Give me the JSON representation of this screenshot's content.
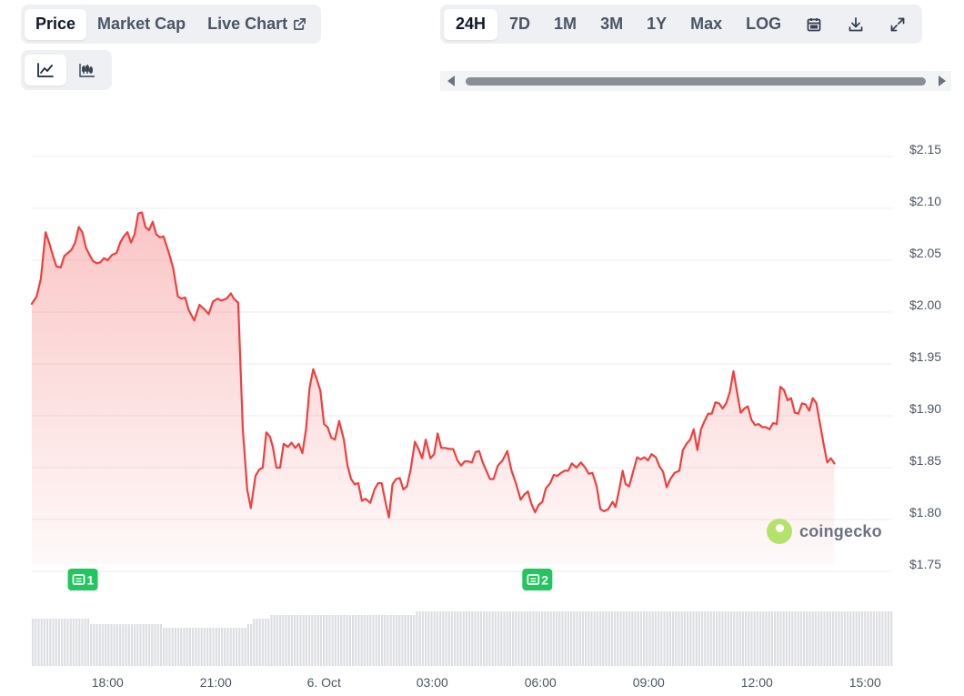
{
  "tabs": [
    {
      "label": "Price",
      "active": true
    },
    {
      "label": "Market Cap",
      "active": false
    },
    {
      "label": "Live Chart",
      "active": false,
      "icon": "external-link-icon"
    }
  ],
  "view_toggles": [
    {
      "name": "line-chart-icon",
      "active": true
    },
    {
      "name": "candlestick-icon",
      "active": false
    }
  ],
  "ranges": [
    {
      "label": "24H",
      "active": true
    },
    {
      "label": "7D",
      "active": false
    },
    {
      "label": "1M",
      "active": false
    },
    {
      "label": "3M",
      "active": false
    },
    {
      "label": "1Y",
      "active": false
    },
    {
      "label": "Max",
      "active": false
    },
    {
      "label": "LOG",
      "active": false
    }
  ],
  "range_icons": [
    "calendar-icon",
    "download-icon",
    "expand-icon"
  ],
  "watermark": {
    "text": "coingecko",
    "icon": "gecko-logo-icon"
  },
  "colors": {
    "line": "#ef3f3f",
    "event": "#22c55e",
    "volume": "#dcdee2",
    "grid": "#eceef1"
  },
  "chart_data": {
    "type": "area",
    "title": "",
    "xlabel": "",
    "ylabel": "",
    "ylim": [
      1.75,
      2.15
    ],
    "y_ticks": [
      "$2.15",
      "$2.10",
      "$2.05",
      "$2.00",
      "$1.95",
      "$1.90",
      "$1.85",
      "$1.80",
      "$1.75"
    ],
    "y_tick_values": [
      2.15,
      2.1,
      2.05,
      2.0,
      1.95,
      1.9,
      1.85,
      1.8,
      1.75
    ],
    "x_ticks": [
      "18:00",
      "21:00",
      "6. Oct",
      "03:00",
      "06:00",
      "09:00",
      "12:00",
      "15:00"
    ],
    "x_tick_hours": [
      18,
      21,
      24,
      27,
      30,
      33,
      36,
      39
    ],
    "x_range_hours": [
      15.9,
      39.75
    ],
    "grid": true,
    "legend": "none",
    "events": [
      {
        "label": "1",
        "hour": 17.3
      },
      {
        "label": "2",
        "hour": 29.9
      }
    ],
    "series": [
      {
        "points": [
          [
            15.9,
            2.001
          ],
          [
            16.03,
            2.008
          ],
          [
            16.15,
            2.025
          ],
          [
            16.28,
            2.07
          ],
          [
            16.38,
            2.06
          ],
          [
            16.48,
            2.048
          ],
          [
            16.58,
            2.037
          ],
          [
            16.7,
            2.036
          ],
          [
            16.8,
            2.047
          ],
          [
            16.9,
            2.05
          ],
          [
            17.0,
            2.053
          ],
          [
            17.1,
            2.06
          ],
          [
            17.2,
            2.075
          ],
          [
            17.3,
            2.07
          ],
          [
            17.4,
            2.055
          ],
          [
            17.5,
            2.048
          ],
          [
            17.6,
            2.042
          ],
          [
            17.7,
            2.04
          ],
          [
            17.8,
            2.041
          ],
          [
            17.9,
            2.045
          ],
          [
            18.0,
            2.043
          ],
          [
            18.12,
            2.048
          ],
          [
            18.25,
            2.05
          ],
          [
            18.35,
            2.06
          ],
          [
            18.45,
            2.066
          ],
          [
            18.55,
            2.07
          ],
          [
            18.65,
            2.06
          ],
          [
            18.75,
            2.068
          ],
          [
            18.85,
            2.088
          ],
          [
            18.95,
            2.089
          ],
          [
            19.05,
            2.075
          ],
          [
            19.15,
            2.072
          ],
          [
            19.25,
            2.08
          ],
          [
            19.35,
            2.068
          ],
          [
            19.45,
            2.065
          ],
          [
            19.55,
            2.066
          ],
          [
            19.7,
            2.05
          ],
          [
            19.82,
            2.035
          ],
          [
            19.95,
            2.008
          ],
          [
            20.05,
            2.006
          ],
          [
            20.15,
            2.007
          ],
          [
            20.25,
            1.995
          ],
          [
            20.4,
            1.985
          ],
          [
            20.55,
            2.0
          ],
          [
            20.7,
            1.995
          ],
          [
            20.8,
            1.991
          ],
          [
            20.92,
            2.003
          ],
          [
            21.05,
            2.006
          ],
          [
            21.15,
            2.004
          ],
          [
            21.3,
            2.006
          ],
          [
            21.42,
            2.011
          ],
          [
            21.5,
            2.006
          ],
          [
            21.62,
            2.002
          ],
          [
            21.75,
            1.88
          ],
          [
            21.87,
            1.822
          ],
          [
            21.97,
            1.804
          ],
          [
            22.1,
            1.835
          ],
          [
            22.2,
            1.841
          ],
          [
            22.3,
            1.843
          ],
          [
            22.4,
            1.877
          ],
          [
            22.5,
            1.873
          ],
          [
            22.58,
            1.863
          ],
          [
            22.68,
            1.843
          ],
          [
            22.78,
            1.843
          ],
          [
            22.88,
            1.866
          ],
          [
            23.0,
            1.863
          ],
          [
            23.1,
            1.867
          ],
          [
            23.2,
            1.862
          ],
          [
            23.3,
            1.866
          ],
          [
            23.4,
            1.857
          ],
          [
            23.5,
            1.88
          ],
          [
            23.6,
            1.92
          ],
          [
            23.7,
            1.938
          ],
          [
            23.8,
            1.928
          ],
          [
            23.9,
            1.917
          ],
          [
            24.0,
            1.885
          ],
          [
            24.1,
            1.882
          ],
          [
            24.2,
            1.872
          ],
          [
            24.3,
            1.87
          ],
          [
            24.42,
            1.888
          ],
          [
            24.55,
            1.87
          ],
          [
            24.65,
            1.845
          ],
          [
            24.75,
            1.832
          ],
          [
            24.85,
            1.827
          ],
          [
            24.95,
            1.828
          ],
          [
            25.05,
            1.811
          ],
          [
            25.15,
            1.813
          ],
          [
            25.28,
            1.809
          ],
          [
            25.4,
            1.822
          ],
          [
            25.5,
            1.828
          ],
          [
            25.6,
            1.828
          ],
          [
            25.72,
            1.807
          ],
          [
            25.8,
            1.795
          ],
          [
            25.9,
            1.827
          ],
          [
            26.0,
            1.832
          ],
          [
            26.1,
            1.833
          ],
          [
            26.2,
            1.822
          ],
          [
            26.3,
            1.825
          ],
          [
            26.4,
            1.841
          ],
          [
            26.52,
            1.868
          ],
          [
            26.62,
            1.861
          ],
          [
            26.72,
            1.852
          ],
          [
            26.82,
            1.87
          ],
          [
            26.95,
            1.852
          ],
          [
            27.05,
            1.856
          ],
          [
            27.15,
            1.876
          ],
          [
            27.25,
            1.862
          ],
          [
            27.35,
            1.862
          ],
          [
            27.48,
            1.861
          ],
          [
            27.58,
            1.861
          ],
          [
            27.7,
            1.85
          ],
          [
            27.8,
            1.845
          ],
          [
            27.9,
            1.849
          ],
          [
            28.0,
            1.849
          ],
          [
            28.1,
            1.848
          ],
          [
            28.2,
            1.858
          ],
          [
            28.3,
            1.859
          ],
          [
            28.4,
            1.848
          ],
          [
            28.5,
            1.84
          ],
          [
            28.6,
            1.832
          ],
          [
            28.7,
            1.832
          ],
          [
            28.82,
            1.845
          ],
          [
            28.95,
            1.85
          ],
          [
            29.08,
            1.859
          ],
          [
            29.2,
            1.84
          ],
          [
            29.32,
            1.828
          ],
          [
            29.45,
            1.812
          ],
          [
            29.55,
            1.817
          ],
          [
            29.65,
            1.82
          ],
          [
            29.75,
            1.808
          ],
          [
            29.85,
            1.8
          ],
          [
            29.95,
            1.807
          ],
          [
            30.05,
            1.81
          ],
          [
            30.15,
            1.823
          ],
          [
            30.27,
            1.828
          ],
          [
            30.37,
            1.836
          ],
          [
            30.47,
            1.835
          ],
          [
            30.57,
            1.838
          ],
          [
            30.67,
            1.84
          ],
          [
            30.77,
            1.84
          ],
          [
            30.87,
            1.847
          ],
          [
            31.0,
            1.843
          ],
          [
            31.12,
            1.848
          ],
          [
            31.24,
            1.843
          ],
          [
            31.34,
            1.837
          ],
          [
            31.44,
            1.838
          ],
          [
            31.56,
            1.825
          ],
          [
            31.66,
            1.803
          ],
          [
            31.76,
            1.801
          ],
          [
            31.88,
            1.803
          ],
          [
            32.0,
            1.81
          ],
          [
            32.08,
            1.805
          ],
          [
            32.18,
            1.821
          ],
          [
            32.28,
            1.84
          ],
          [
            32.36,
            1.827
          ],
          [
            32.46,
            1.825
          ],
          [
            32.56,
            1.838
          ],
          [
            32.68,
            1.853
          ],
          [
            32.78,
            1.851
          ],
          [
            32.88,
            1.853
          ],
          [
            32.98,
            1.85
          ],
          [
            33.08,
            1.856
          ],
          [
            33.2,
            1.853
          ],
          [
            33.3,
            1.844
          ],
          [
            33.4,
            1.839
          ],
          [
            33.5,
            1.824
          ],
          [
            33.6,
            1.832
          ],
          [
            33.72,
            1.838
          ],
          [
            33.85,
            1.84
          ],
          [
            33.95,
            1.86
          ],
          [
            34.05,
            1.866
          ],
          [
            34.15,
            1.87
          ],
          [
            34.25,
            1.88
          ],
          [
            34.35,
            1.86
          ],
          [
            34.45,
            1.88
          ],
          [
            34.55,
            1.888
          ],
          [
            34.65,
            1.895
          ],
          [
            34.75,
            1.895
          ],
          [
            34.85,
            1.906
          ],
          [
            34.95,
            1.905
          ],
          [
            35.05,
            1.9
          ],
          [
            35.15,
            1.905
          ],
          [
            35.25,
            1.916
          ],
          [
            35.35,
            1.936
          ],
          [
            35.45,
            1.916
          ],
          [
            35.55,
            1.896
          ],
          [
            35.65,
            1.9
          ],
          [
            35.75,
            1.902
          ],
          [
            35.85,
            1.889
          ],
          [
            35.95,
            1.884
          ],
          [
            36.05,
            1.885
          ],
          [
            36.15,
            1.882
          ],
          [
            36.25,
            1.882
          ],
          [
            36.35,
            1.88
          ],
          [
            36.45,
            1.886
          ],
          [
            36.55,
            1.885
          ],
          [
            36.65,
            1.921
          ],
          [
            36.75,
            1.918
          ],
          [
            36.85,
            1.908
          ],
          [
            36.95,
            1.91
          ],
          [
            37.05,
            1.896
          ],
          [
            37.15,
            1.895
          ],
          [
            37.25,
            1.905
          ],
          [
            37.35,
            1.904
          ],
          [
            37.45,
            1.898
          ],
          [
            37.55,
            1.91
          ],
          [
            37.65,
            1.905
          ],
          [
            37.75,
            1.885
          ],
          [
            37.85,
            1.866
          ],
          [
            37.95,
            1.848
          ],
          [
            38.05,
            1.852
          ],
          [
            38.15,
            1.847
          ]
        ]
      }
    ]
  }
}
